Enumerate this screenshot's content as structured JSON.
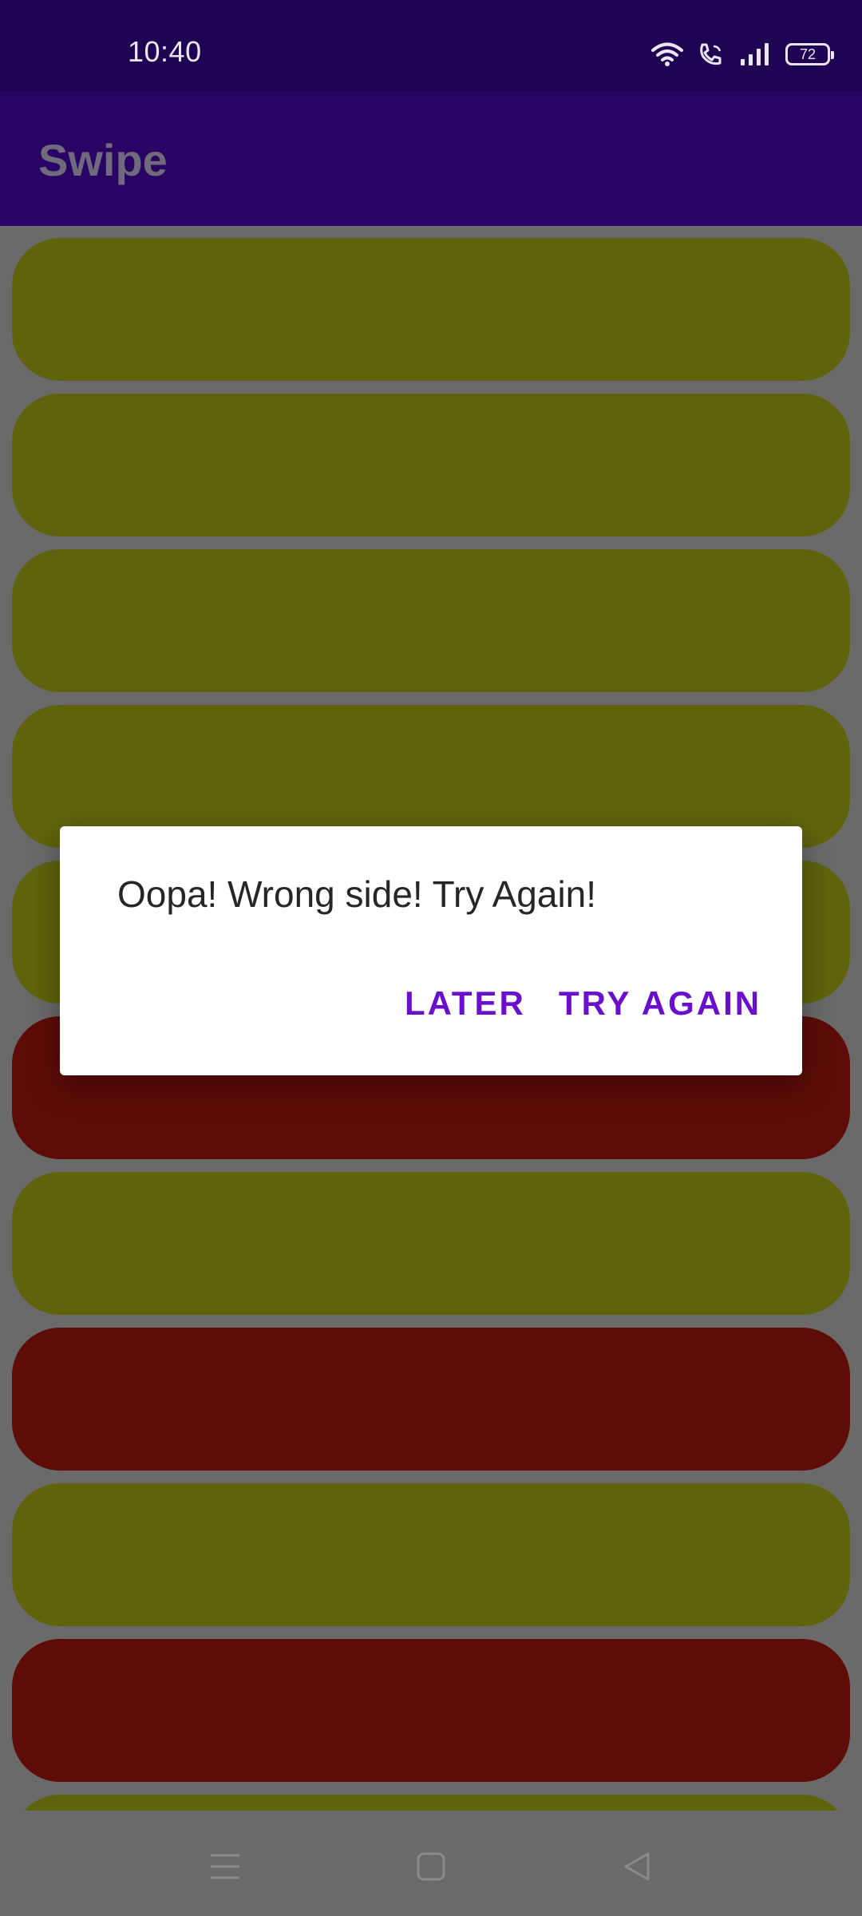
{
  "status_bar": {
    "time": "10:40",
    "battery": "72",
    "icons": [
      "wifi-icon",
      "wifi-call-icon",
      "signal-icon",
      "battery-icon"
    ]
  },
  "app_bar": {
    "title": "Swipe"
  },
  "list": {
    "cards": [
      {
        "color": "yellow"
      },
      {
        "color": "yellow"
      },
      {
        "color": "yellow"
      },
      {
        "color": "yellow"
      },
      {
        "color": "yellow"
      },
      {
        "color": "red"
      },
      {
        "color": "yellow"
      },
      {
        "color": "red"
      },
      {
        "color": "yellow"
      },
      {
        "color": "red"
      },
      {
        "color": "yellow"
      }
    ],
    "colors": {
      "yellow": "#5f640c",
      "red": "#5d0c08"
    }
  },
  "dialog": {
    "message": "Oopa! Wrong side! Try Again!",
    "later_label": "LATER",
    "try_again_label": "TRY AGAIN",
    "accent": "#6a0fcc"
  },
  "nav_bar": {
    "icons": [
      "menu-icon",
      "home-icon",
      "back-icon"
    ]
  }
}
